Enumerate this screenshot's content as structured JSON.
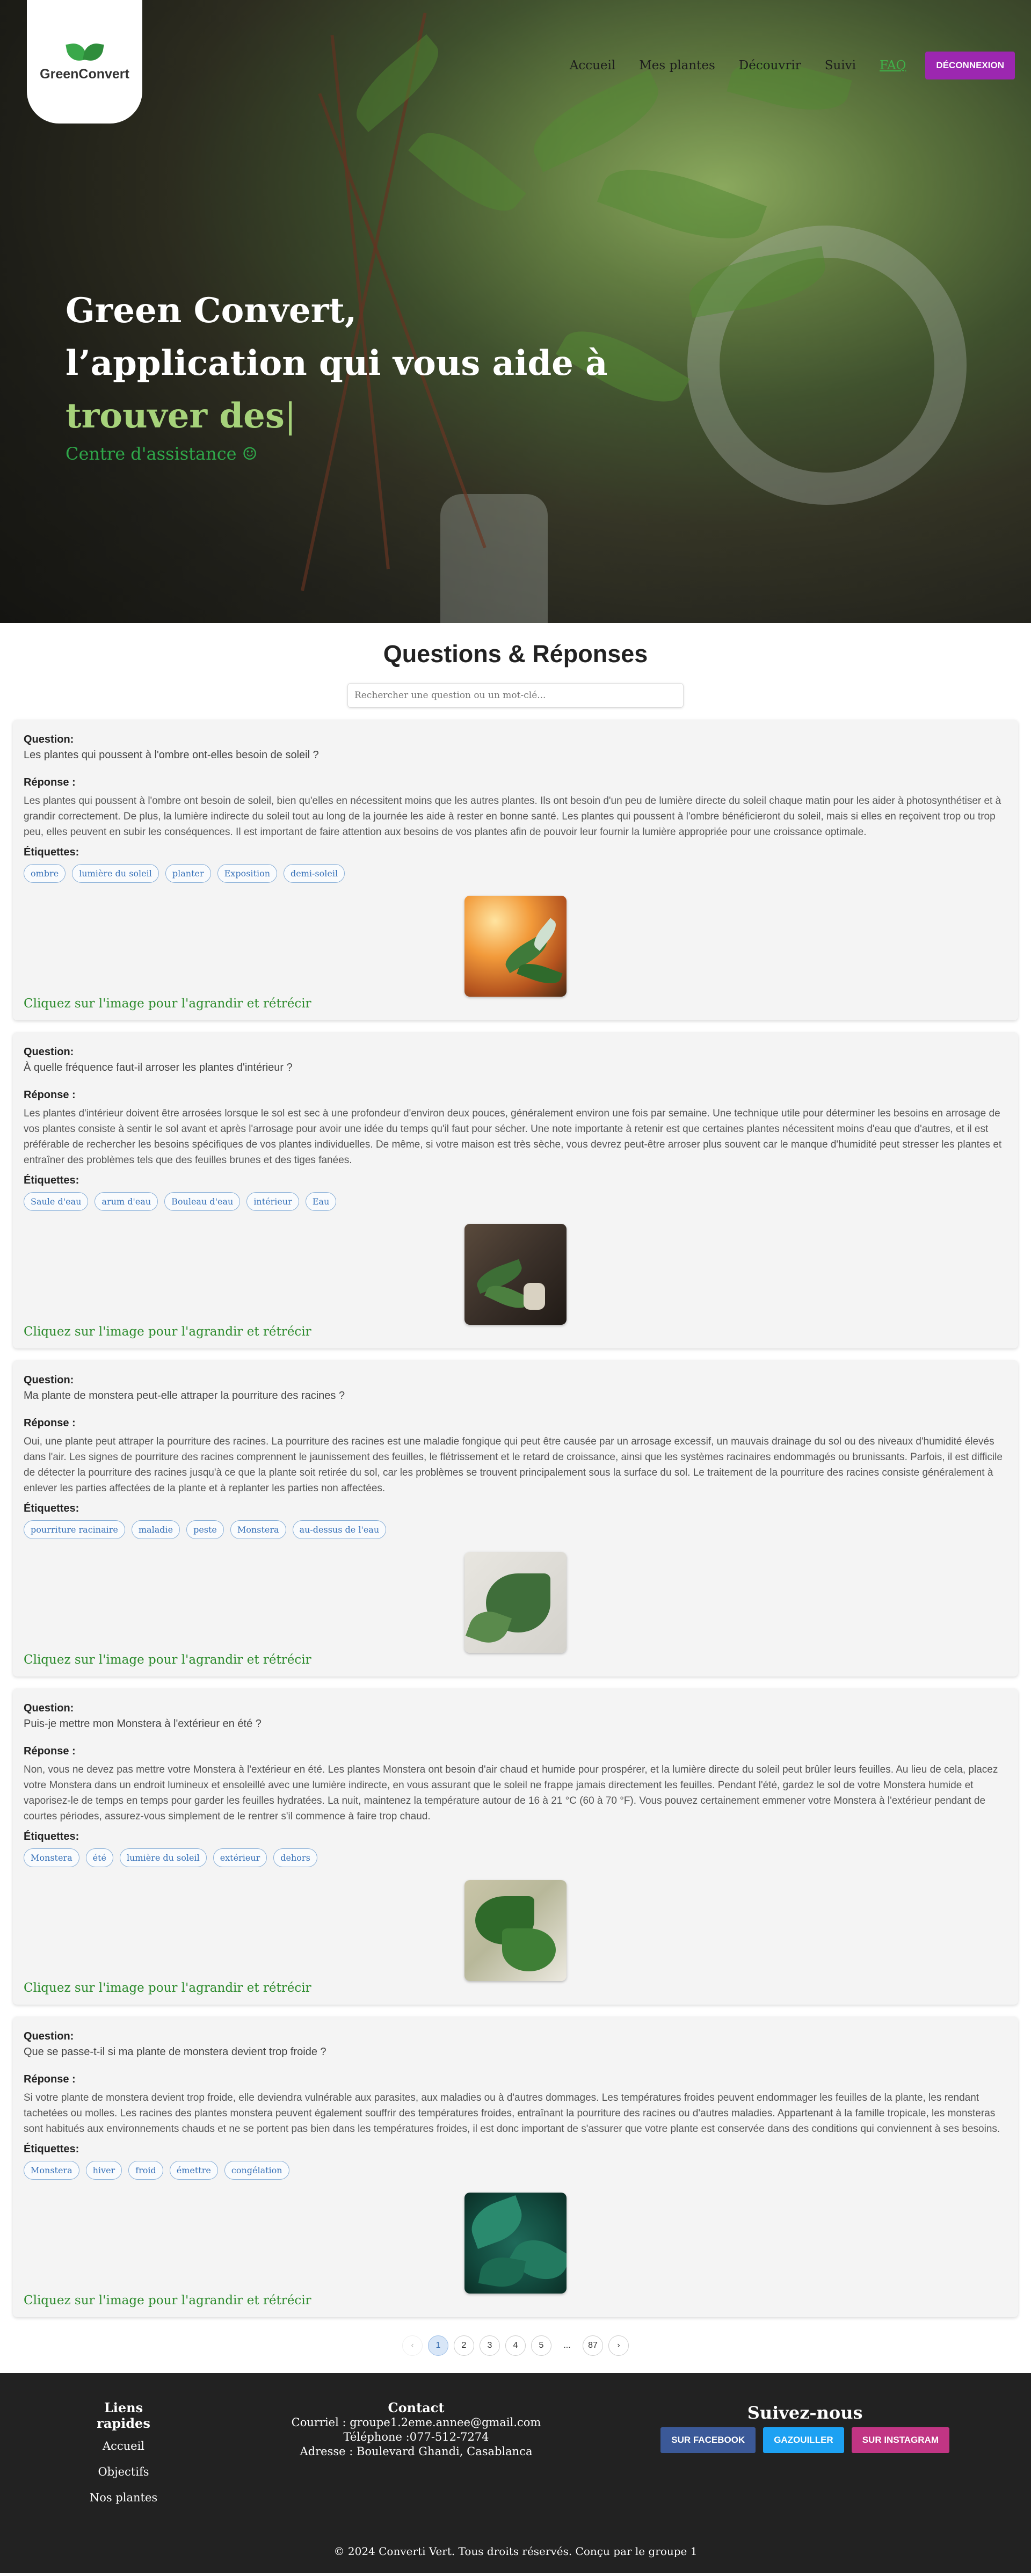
{
  "brand": {
    "name": "GreenConvert"
  },
  "nav": {
    "items": [
      {
        "label": "Accueil"
      },
      {
        "label": "Mes plantes"
      },
      {
        "label": "Découvrir"
      },
      {
        "label": "Suivi"
      },
      {
        "label": "FAQ",
        "active": true
      }
    ],
    "logout_label": "DÉCONNEXION",
    "logout_color": "#9c27b0"
  },
  "hero": {
    "line1": "Green Convert,",
    "line2": "l’application qui vous aide à",
    "typed": "trouver des",
    "cursor": "|",
    "subtitle": "Centre d'assistance ☺"
  },
  "faq": {
    "title": "Questions & Réponses",
    "search_placeholder": "Rechercher une question ou un mot-clé...",
    "question_label": "Question:",
    "answer_label": "Réponse :",
    "tags_label": "Étiquettes:",
    "image_hint": "Cliquez sur l'image pour l'agrandir et rétrécir",
    "items": [
      {
        "question": "Les plantes qui poussent à l'ombre ont-elles besoin de soleil ?",
        "answer": "Les plantes qui poussent à l'ombre ont besoin de soleil, bien qu'elles en nécessitent moins que les autres plantes. Ils ont besoin d'un peu de lumière directe du soleil chaque matin pour les aider à photosynthétiser et à grandir correctement. De plus, la lumière indirecte du soleil tout au long de la journée les aide à rester en bonne santé. Les plantes qui poussent à l'ombre bénéficieront du soleil, mais si elles en reçoivent trop ou trop peu, elles peuvent en subir les conséquences. Il est important de faire attention aux besoins de vos plantes afin de pouvoir leur fournir la lumière appropriée pour une croissance optimale.",
        "tags": [
          "ombre",
          "lumière du soleil",
          "planter",
          "Exposition",
          "demi-soleil"
        ],
        "image_icon": "sunlit-fern-photo"
      },
      {
        "question": "À quelle fréquence faut-il arroser les plantes d'intérieur ?",
        "answer": "Les plantes d'intérieur doivent être arrosées lorsque le sol est sec à une profondeur d'environ deux pouces, généralement environ une fois par semaine. Une technique utile pour déterminer les besoins en arrosage de vos plantes consiste à sentir le sol avant et après l'arrosage pour avoir une idée du temps qu'il faut pour sécher. Une note importante à retenir est que certaines plantes nécessitent moins d'eau que d'autres, et il est préférable de rechercher les besoins spécifiques de vos plantes individuelles. De même, si votre maison est très sèche, vous devrez peut-être arroser plus souvent car le manque d'humidité peut stresser les plantes et entraîner des problèmes tels que des feuilles brunes et des tiges fanées.",
        "tags": [
          "Saule d'eau",
          "arum d'eau",
          "Bouleau d'eau",
          "intérieur",
          "Eau"
        ],
        "image_icon": "watering-plant-photo"
      },
      {
        "question": "Ma plante de monstera peut-elle attraper la pourriture des racines ?",
        "answer": "Oui, une plante peut attraper la pourriture des racines. La pourriture des racines est une maladie fongique qui peut être causée par un arrosage excessif, un mauvais drainage du sol ou des niveaux d'humidité élevés dans l'air. Les signes de pourriture des racines comprennent le jaunissement des feuilles, le flétrissement et le retard de croissance, ainsi que les systèmes racinaires endommagés ou brunissants. Parfois, il est difficile de détecter la pourriture des racines jusqu'à ce que la plante soit retirée du sol, car les problèmes se trouvent principalement sous la surface du sol. Le traitement de la pourriture des racines consiste généralement à enlever les parties affectées de la plante et à replanter les parties non affectées.",
        "tags": [
          "pourriture racinaire",
          "maladie",
          "peste",
          "Monstera",
          "au-dessus de l'eau"
        ],
        "image_icon": "monstera-leaf-photo"
      },
      {
        "question": "Puis-je mettre mon Monstera à l'extérieur en été ?",
        "answer": "Non, vous ne devez pas mettre votre Monstera à l'extérieur en été. Les plantes Monstera ont besoin d'air chaud et humide pour prospérer, et la lumière directe du soleil peut brûler leurs feuilles. Au lieu de cela, placez votre Monstera dans un endroit lumineux et ensoleillé avec une lumière indirecte, en vous assurant que le soleil ne frappe jamais directement les feuilles. Pendant l'été, gardez le sol de votre Monstera humide et vaporisez-le de temps en temps pour garder les feuilles hydratées. La nuit, maintenez la température autour de 16 à 21 °C (60 à 70 °F). Vous pouvez certainement emmener votre Monstera à l'extérieur pendant de courtes périodes, assurez-vous simplement de le rentrer s'il commence à faire trop chaud.",
        "tags": [
          "Monstera",
          "été",
          "lumière du soleil",
          "extérieur",
          "dehors"
        ],
        "image_icon": "potted-monstera-photo"
      },
      {
        "question": "Que se passe-t-il si ma plante de monstera devient trop froide ?",
        "answer": "Si votre plante de monstera devient trop froide, elle deviendra vulnérable aux parasites, aux maladies ou à d'autres dommages. Les températures froides peuvent endommager les feuilles de la plante, les rendant tachetées ou molles. Les racines des plantes monstera peuvent également souffrir des températures froides, entraînant la pourriture des racines ou d'autres maladies. Appartenant à la famille tropicale, les monsteras sont habitués aux environnements chauds et ne se portent pas bien dans les températures froides, il est donc important de s'assurer que votre plante est conservée dans des conditions qui conviennent à ses besoins.",
        "tags": [
          "Monstera",
          "hiver",
          "froid",
          "émettre",
          "congélation"
        ],
        "image_icon": "tropical-leaves-photo"
      }
    ]
  },
  "pagination": {
    "prev": "‹",
    "pages": [
      "1",
      "2",
      "3",
      "4",
      "5"
    ],
    "ellipsis": "...",
    "last": "87",
    "next": "›",
    "current": 1
  },
  "footer": {
    "links_title": "Liens rapides",
    "links": [
      "Accueil",
      "Objectifs",
      "Nos plantes"
    ],
    "contact_title": "Contact",
    "email": "Courriel : groupe1.2eme.annee@gmail.com",
    "phone": "Téléphone :077-512-7274",
    "address": "Adresse : Boulevard Ghandi, Casablanca",
    "social_title": "Suivez-nous",
    "social": [
      {
        "label": "SUR FACEBOOK",
        "color": "#3b5998"
      },
      {
        "label": "GAZOUILLER",
        "color": "#1da1f2"
      },
      {
        "label": "SUR INSTAGRAM",
        "color": "#c13584"
      }
    ],
    "copyright": "© 2024 Converti Vert. Tous droits réservés. Conçu par le groupe 1"
  }
}
